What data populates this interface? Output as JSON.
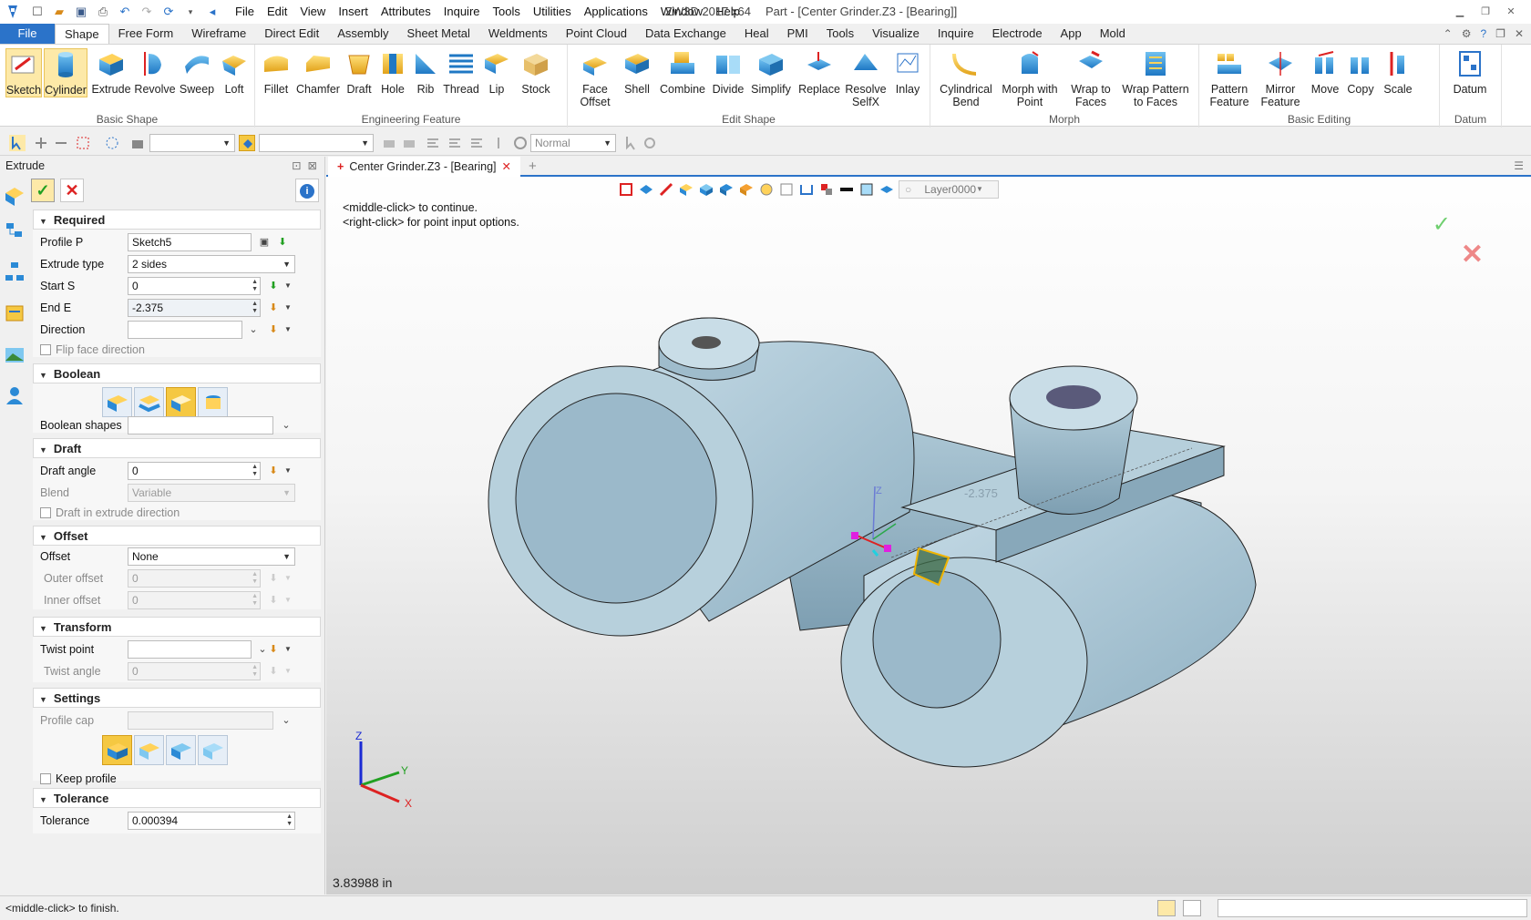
{
  "app": {
    "window_title": "ZW3D 2017  x64",
    "doc_title": "Part - [Center Grinder.Z3 - [Bearing]]",
    "menu": [
      "Edit",
      "View",
      "Insert",
      "Attributes",
      "Inquire",
      "Tools",
      "Utilities",
      "Applications",
      "Window",
      "Help"
    ],
    "first_menu": "File"
  },
  "ribbon": {
    "tabs": [
      "File",
      "Shape",
      "Free Form",
      "Wireframe",
      "Direct Edit",
      "Assembly",
      "Sheet Metal",
      "Weldments",
      "Point Cloud",
      "Data Exchange",
      "Heal",
      "PMI",
      "Tools",
      "Visualize",
      "Inquire",
      "Electrode",
      "App",
      "Mold"
    ],
    "active_tab": "Shape",
    "groups": {
      "basic_shape": {
        "label": "Basic Shape",
        "buttons": [
          "Sketch",
          "Cylinder",
          "Extrude",
          "Revolve",
          "Sweep",
          "Loft"
        ]
      },
      "engineering": {
        "label": "Engineering Feature",
        "buttons": [
          "Fillet",
          "Chamfer",
          "Draft",
          "Hole",
          "Rib",
          "Thread",
          "Lip",
          "Stock"
        ]
      },
      "edit_shape": {
        "label": "Edit Shape",
        "buttons": [
          "Face\nOffset",
          "Shell",
          "Combine",
          "Divide",
          "Simplify",
          "Replace",
          "Resolve\nSelfX",
          "Inlay"
        ]
      },
      "morph": {
        "label": "Morph",
        "buttons": [
          "Cylindrical\nBend",
          "Morph with\nPoint",
          "Wrap to\nFaces",
          "Wrap Pattern\nto Faces"
        ]
      },
      "basic_editing": {
        "label": "Basic Editing",
        "buttons": [
          "Pattern\nFeature",
          "Mirror\nFeature",
          "Move",
          "Copy",
          "Scale"
        ]
      },
      "datum": {
        "label": "Datum",
        "buttons": [
          "Datum"
        ]
      }
    }
  },
  "toolbar": {
    "render_mode": "Normal"
  },
  "panel": {
    "title": "Extrude",
    "required": {
      "label": "Required",
      "profile_label": "Profile P",
      "profile_value": "Sketch5",
      "type_label": "Extrude type",
      "type_value": "2 sides",
      "start_label": "Start S",
      "start_value": "0",
      "end_label": "End E",
      "end_value": "-2.375",
      "direction_label": "Direction",
      "direction_value": "",
      "flip_label": "Flip face direction"
    },
    "boolean": {
      "label": "Boolean",
      "shapes_label": "Boolean shapes"
    },
    "draft": {
      "label": "Draft",
      "angle_label": "Draft angle",
      "angle_value": "0",
      "blend_label": "Blend",
      "blend_value": "Variable",
      "extrude_dir_label": "Draft in extrude direction"
    },
    "offset": {
      "label": "Offset",
      "offset_label": "Offset",
      "offset_value": "None",
      "outer_label": "Outer offset",
      "outer_value": "0",
      "inner_label": "Inner offset",
      "inner_value": "0"
    },
    "transform": {
      "label": "Transform",
      "twist_point_label": "Twist point",
      "twist_angle_label": "Twist angle",
      "twist_angle_value": "0"
    },
    "settings": {
      "label": "Settings",
      "profile_cap_label": "Profile cap",
      "keep_profile_label": "Keep profile"
    },
    "tolerance": {
      "label": "Tolerance",
      "tol_label": "Tolerance",
      "tol_value": "0.000394"
    }
  },
  "viewport": {
    "doc_tab": "Center Grinder.Z3 - [Bearing]",
    "layer": "Layer0000",
    "hint_1": "<middle-click> to continue.",
    "hint_2": "<right-click> for point input options.",
    "measurement": "3.83988 in",
    "dim_label": "-2.375",
    "axis_x": "X",
    "axis_y": "Y",
    "axis_z": "Z"
  },
  "status": {
    "text": "<middle-click> to finish."
  },
  "colors": {
    "part": "#a9c4d2",
    "accent": "#2b73c9",
    "highlight": "#f5c842"
  }
}
